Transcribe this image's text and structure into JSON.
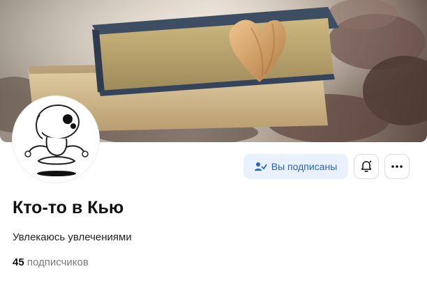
{
  "profile": {
    "name": "Кто-то в Кью",
    "description": "Увлекаюсь увлечениями",
    "subscribers_count": "45",
    "subscribers_label": "подписчиков"
  },
  "actions": {
    "subscribed_label": "Вы подписаны",
    "subscribed_icon": "user-check-icon",
    "bell_icon": "bell-icon",
    "more_icon": "more-dots-icon"
  },
  "colors": {
    "accent_text": "#2864c8",
    "accent_bg": "#e8f1fc",
    "muted_text": "#7a7a7a"
  }
}
